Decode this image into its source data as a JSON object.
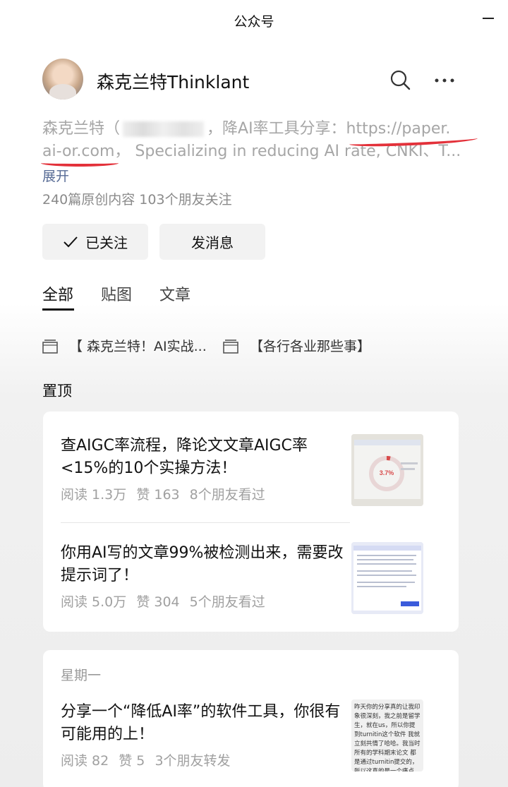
{
  "window": {
    "title": "公众号"
  },
  "account": {
    "name": "森克兰特Thinklant",
    "desc_line1_a": "森克兰特（",
    "desc_line1_b": "，降AI率工具分享：https://paper.",
    "desc_line2": "ai-or.com， Specializing in reducing AI rate, CNKI、T...",
    "expand": "展开",
    "stats": "240篇原创内容  103个朋友关注"
  },
  "actions": {
    "follow": "已关注",
    "message": "发消息"
  },
  "tabs": [
    "全部",
    "贴图",
    "文章"
  ],
  "albums": [
    "【 森克兰特！AI实战...",
    "【各行各业那些事】"
  ],
  "pinned_title": "置顶",
  "pinned": [
    {
      "title": "查AIGC率流程，降论文文章AIGC率<15%的10个实操方法！",
      "reads": "阅读 1.3万",
      "likes": "赞 163",
      "friends": "8个朋友看过",
      "thumb_text": "3.7%"
    },
    {
      "title": "你用AI写的文章99%被检测出来，需要改提示词了！",
      "reads": "阅读 5.0万",
      "likes": "赞 304",
      "friends": "5个朋友看过"
    }
  ],
  "recent": {
    "day": "星期一",
    "title": "分享一个“降低AI率”的软件工具，你很有可能用的上！",
    "reads": "阅读 82",
    "likes": "赞 5",
    "friends": "3个朋友转发",
    "thumb_text": "昨天你的分享真的让我印象很深刻，我之前是留学生，就在us，所以你提到turnitin这个软件 我就立刻共情了哈哈。我当时所有的学科期末论文 都是通过turnitin提交的，所以这真的是一个痛点"
  }
}
